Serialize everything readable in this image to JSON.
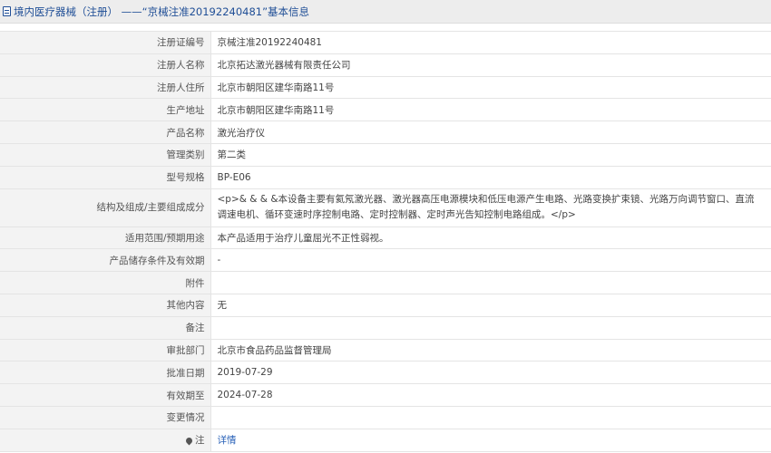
{
  "header": {
    "title": "境内医疗器械（注册） ——“京械注准20192240481”基本信息"
  },
  "rows": [
    {
      "label": "注册证编号",
      "value": "京械注准20192240481"
    },
    {
      "label": "注册人名称",
      "value": "北京拓达激光器械有限责任公司"
    },
    {
      "label": "注册人住所",
      "value": "北京市朝阳区建华南路11号"
    },
    {
      "label": "生产地址",
      "value": "北京市朝阳区建华南路11号"
    },
    {
      "label": "产品名称",
      "value": "激光治疗仪"
    },
    {
      "label": "管理类别",
      "value": "第二类"
    },
    {
      "label": "型号规格",
      "value": "BP-E06"
    },
    {
      "label": "结构及组成/主要组成成分",
      "value": "<p>& & & &本设备主要有氦氖激光器、激光器高压电源模块和低压电源产生电路、光路变换扩束镜、光路万向调节窗口、直流调速电机、循环变速时序控制电路、定时控制器、定时声光告知控制电路组成。</p>"
    },
    {
      "label": "适用范围/预期用途",
      "value": "本产品适用于治疗儿童屈光不正性弱视。"
    },
    {
      "label": "产品储存条件及有效期",
      "value": "-"
    },
    {
      "label": "附件",
      "value": ""
    },
    {
      "label": "其他内容",
      "value": "无"
    },
    {
      "label": "备注",
      "value": ""
    },
    {
      "label": "审批部门",
      "value": "北京市食品药品监督管理局"
    },
    {
      "label": "批准日期",
      "value": "2019-07-29"
    },
    {
      "label": "有效期至",
      "value": "2024-07-28"
    },
    {
      "label": "变更情况",
      "value": ""
    },
    {
      "label": "注",
      "value": "详情",
      "icon": "pin-icon"
    }
  ]
}
